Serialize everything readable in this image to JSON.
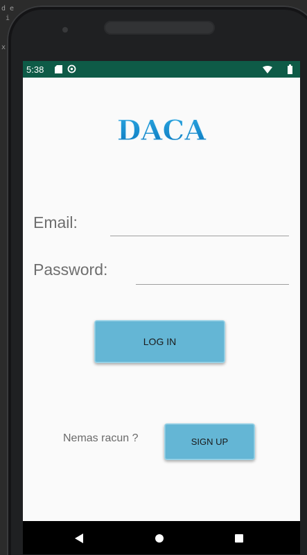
{
  "status_bar": {
    "time": "5:38",
    "icons": [
      "sd-card-icon",
      "sync-icon",
      "wifi-icon",
      "battery-icon"
    ]
  },
  "app": {
    "logo_text": "DACA",
    "logo_color": "#1a8fd0"
  },
  "form": {
    "email_label": "Email:",
    "email_value": "",
    "password_label": "Password:",
    "password_value": ""
  },
  "buttons": {
    "login_label": "LOG IN",
    "signup_label": "SIGN UP",
    "accent_color": "#64b6d5"
  },
  "signup_prompt": "Nemas racun ?",
  "nav_bar": {
    "icons": [
      "back-icon",
      "home-icon",
      "recents-icon"
    ]
  },
  "background_editor_text": "d e\n i\n\n\nx\n\n"
}
